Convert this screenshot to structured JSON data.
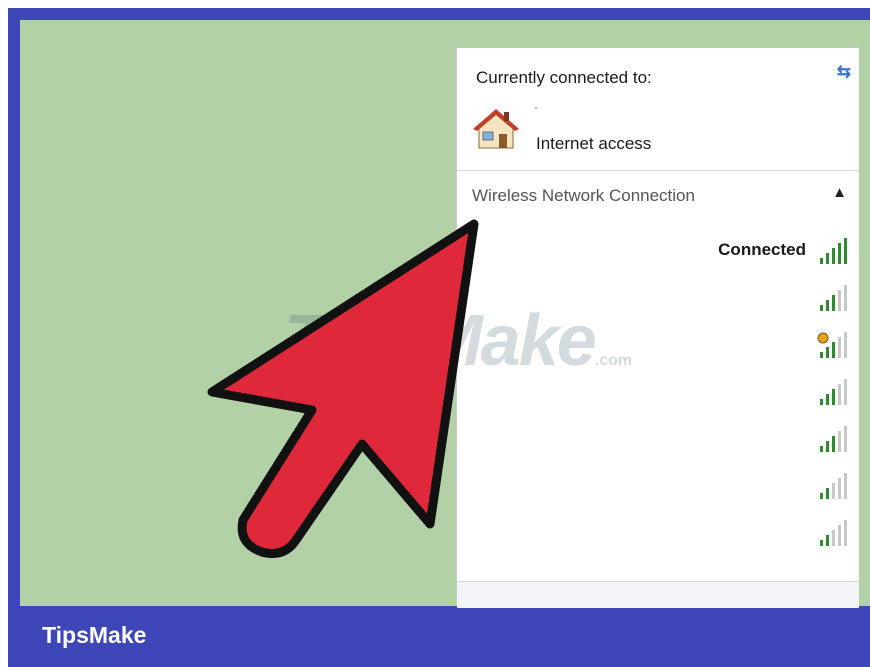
{
  "panel": {
    "connected_to_label": "Currently connected to:",
    "refresh_icon": "refresh-icon",
    "network_status": "Internet access",
    "network_dot": "·",
    "section_label": "Wireless Network Connection",
    "collapse_icon": "chevron-up-icon",
    "networks": [
      {
        "status": "Connected",
        "signal": 5,
        "secured_warning": false
      },
      {
        "status": "",
        "signal": 3,
        "secured_warning": false
      },
      {
        "status": "",
        "signal": 3,
        "secured_warning": true
      },
      {
        "status": "",
        "signal": 3,
        "secured_warning": false
      },
      {
        "status": "",
        "signal": 3,
        "secured_warning": false
      },
      {
        "status": "",
        "signal": 2,
        "secured_warning": false
      },
      {
        "status": "",
        "signal": 2,
        "secured_warning": false
      }
    ]
  },
  "watermark": {
    "main": "TipsMake",
    "suffix": ".com"
  },
  "footer_brand": "TipsMake",
  "colors": {
    "frame": "#3d47b8",
    "desktop": "#b3d1a6",
    "arrow": "#e0283b",
    "signal_on": "#2e8b2e",
    "signal_off": "#c8c8c8"
  }
}
